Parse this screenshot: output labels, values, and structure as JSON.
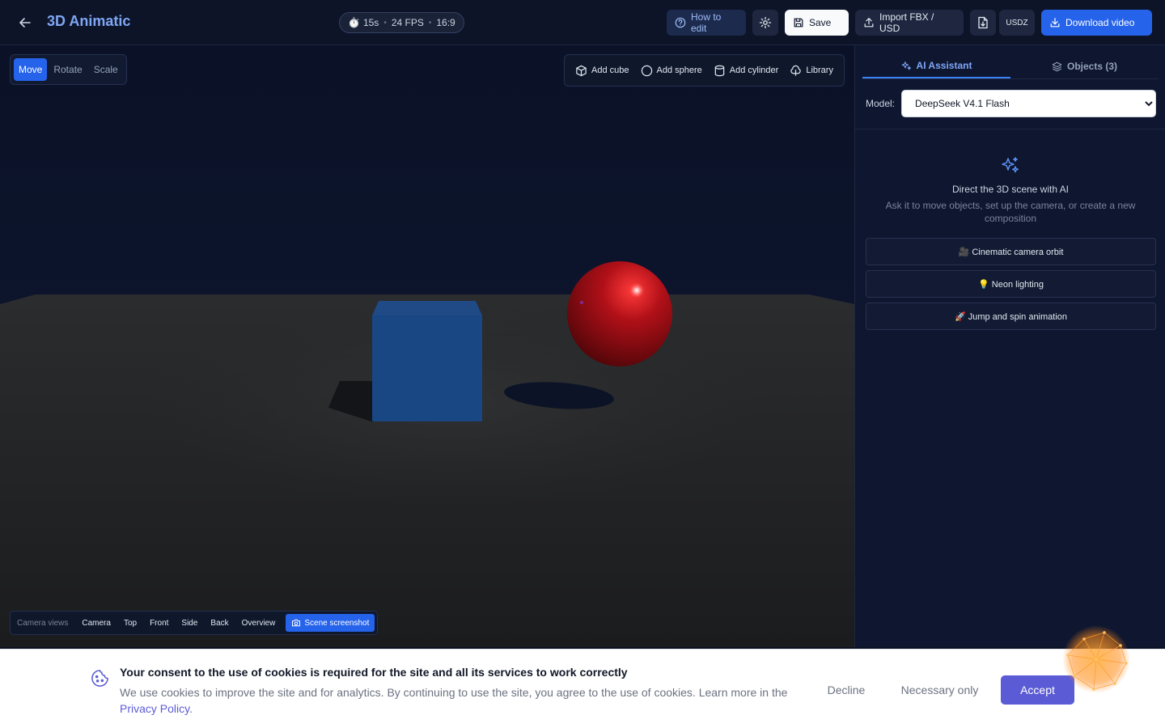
{
  "header": {
    "app_title": "3D Animatic",
    "meta": {
      "duration": "15s",
      "fps": "24 FPS",
      "aspect": "16:9"
    },
    "how_to_edit": "How to edit",
    "save": "Save",
    "import": "Import FBX / USD",
    "usdz": "USDZ",
    "download": "Download video"
  },
  "transform": {
    "modes": [
      "Move",
      "Rotate",
      "Scale"
    ],
    "active": "Move"
  },
  "add_bar": {
    "cube": "Add cube",
    "sphere": "Add sphere",
    "cylinder": "Add cylinder",
    "library": "Library"
  },
  "camera_bar": {
    "label": "Camera views",
    "views": [
      "Camera",
      "Top",
      "Front",
      "Side",
      "Back",
      "Overview"
    ],
    "screenshot": "Scene screenshot"
  },
  "scene": {
    "objects": [
      {
        "type": "cube",
        "color": "#1d4e8e"
      },
      {
        "type": "sphere",
        "color": "#b11018"
      }
    ]
  },
  "panel": {
    "tabs": {
      "ai": "AI Assistant",
      "objects": "Objects (3)"
    },
    "active_tab": "AI Assistant",
    "model_label": "Model:",
    "model_selected": "DeepSeek V4.1 Flash",
    "ai_title": "Direct the 3D scene with AI",
    "ai_desc": "Ask it to move objects, set up the camera, or create a new composition",
    "suggestions": [
      "🎥 Cinematic camera orbit",
      "💡 Neon lighting",
      "🚀 Jump and spin animation"
    ]
  },
  "cookie": {
    "title": "Your consent to the use of cookies is required for the site and all its services to work correctly",
    "text": "We use cookies to improve the site and for analytics. By continuing to use the site, you agree to the use of cookies. Learn more in the",
    "link": "Privacy Policy",
    "decline": "Decline",
    "necessary": "Necessary only",
    "accept": "Accept"
  },
  "colors": {
    "accent": "#2563eb",
    "brand_title": "#7fa6f5",
    "accept": "#5b5bd6"
  }
}
